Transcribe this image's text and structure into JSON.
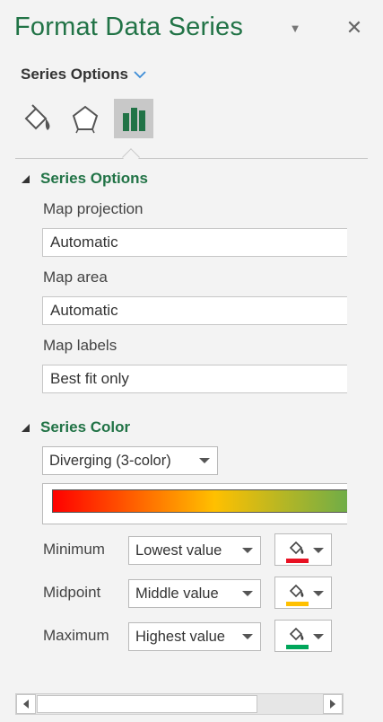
{
  "header": {
    "title": "Format Data Series",
    "options_dropdown": "Series Options",
    "tabs": [
      {
        "icon": "fill-line-icon"
      },
      {
        "icon": "effects-pentagon-icon"
      },
      {
        "icon": "series-options-bar-chart-icon",
        "active": true
      }
    ]
  },
  "series_options": {
    "heading": "Series Options",
    "map_projection": {
      "label": "Map projection",
      "value": "Automatic"
    },
    "map_area": {
      "label": "Map area",
      "value": "Automatic"
    },
    "map_labels": {
      "label": "Map labels",
      "value": "Best fit only"
    }
  },
  "series_color": {
    "heading": "Series Color",
    "scheme": "Diverging (3-color)",
    "gradient": [
      "#ff0000",
      "#ffc000",
      "#70ad47"
    ],
    "stops": [
      {
        "label": "Minimum",
        "value": "Lowest value",
        "color": "#e81123"
      },
      {
        "label": "Midpoint",
        "value": "Middle value",
        "color": "#ffc000"
      },
      {
        "label": "Maximum",
        "value": "Highest value",
        "color": "#00a65a"
      }
    ]
  },
  "colors": {
    "accent": "#217346",
    "pane_bg": "#f3f3f3",
    "link_chevron": "#3c8cd6"
  }
}
